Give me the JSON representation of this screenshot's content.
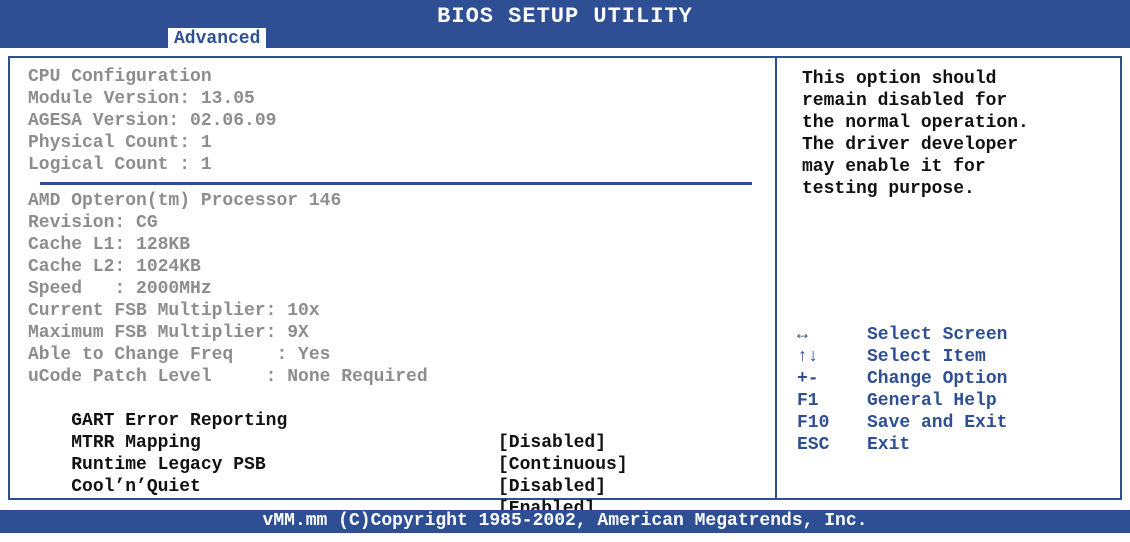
{
  "app": {
    "title": "BIOS SETUP UTILITY",
    "active_tab": "Advanced"
  },
  "info_lines": [
    "CPU Configuration",
    "Module Version: 13.05",
    "AGESA Version: 02.06.09",
    "Physical Count: 1",
    "Logical Count : 1",
    "AMD Opteron(tm) Processor 146",
    "Revision: CG",
    "Cache L1: 128KB",
    "Cache L2: 1024KB",
    "Speed   : 2000MHz",
    "Current FSB Multiplier: 10x",
    "Maximum FSB Multiplier: 9X",
    "Able to Change Freq    : Yes",
    "uCode Patch Level     : None Required"
  ],
  "settings": [
    {
      "label": "GART Error Reporting",
      "value": "[Disabled]"
    },
    {
      "label": "MTRR Mapping",
      "value": "[Continuous]"
    },
    {
      "label": "Runtime Legacy PSB",
      "value": "[Disabled]"
    },
    {
      "label": "Cool’n’Quiet",
      "value": "[Enabled]"
    }
  ],
  "help_text": "This option should\nremain disabled for\nthe normal operation.\nThe driver developer\nmay enable it for\ntesting purpose.",
  "keys": [
    {
      "key": "↔",
      "desc": "Select Screen"
    },
    {
      "key": "↑↓",
      "desc": "Select Item"
    },
    {
      "key": "+-",
      "desc": "Change Option"
    },
    {
      "key": "F1",
      "desc": "General Help"
    },
    {
      "key": "F10",
      "desc": "Save and Exit"
    },
    {
      "key": "ESC",
      "desc": "Exit"
    }
  ],
  "footer": "vMM.mm (C)Copyright 1985-2002, American Megatrends, Inc.",
  "colors": {
    "accent": "#2f4f95",
    "info_text": "#8d8d8d",
    "setting_text": "#111111",
    "background": "#ffffff"
  }
}
